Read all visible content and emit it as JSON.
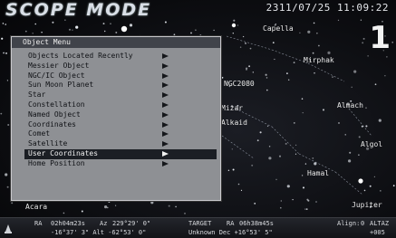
{
  "header": {
    "title": "SCOPE MODE",
    "datetime": "2311/07/25 11:09:22",
    "big_number": "1"
  },
  "sky_labels": [
    {
      "id": "capella",
      "text": "Capella"
    },
    {
      "id": "mirphak",
      "text": "Mirphak"
    },
    {
      "id": "alcor",
      "text": "Alcor"
    },
    {
      "id": "mizar",
      "text": "Mizar"
    },
    {
      "id": "alkaid",
      "text": "Alkaid"
    },
    {
      "id": "almach",
      "text": "Almach"
    },
    {
      "id": "algol",
      "text": "Algol"
    },
    {
      "id": "jupiter",
      "text": "Jupiter"
    },
    {
      "id": "hamal",
      "text": "Hamal"
    },
    {
      "id": "acara",
      "text": "Acara"
    },
    {
      "id": "ngc",
      "text": "NGC2080"
    }
  ],
  "menu": {
    "header": "Object Menu",
    "items": [
      {
        "label": "Objects Located Recently",
        "selected": false
      },
      {
        "label": "Messier Object",
        "selected": false
      },
      {
        "label": "NGC/IC Object",
        "selected": false
      },
      {
        "label": "Sun Moon Planet",
        "selected": false
      },
      {
        "label": "Star",
        "selected": false
      },
      {
        "label": "Constellation",
        "selected": false
      },
      {
        "label": "Named Object",
        "selected": false
      },
      {
        "label": "Coordinates",
        "selected": false
      },
      {
        "label": "Comet",
        "selected": false
      },
      {
        "label": "Satellite",
        "selected": false
      },
      {
        "label": "User Coordinates",
        "selected": true
      },
      {
        "label": "Home Position",
        "selected": false
      }
    ]
  },
  "status": {
    "ra_label": "RA",
    "ra_value": "02h04m23s",
    "az_label": "Az",
    "az_value": "229°29' 0\"",
    "dec_line": "-16°37' 3\"  Alt -62°53' 0\"",
    "target_label": "TARGET",
    "target_ra_label": "RA",
    "target_ra_value": "06h38m45s",
    "target_line": "Unknown Dec +16°53' 5\"",
    "align_label": "Align:",
    "align_value": "0",
    "alta_label": "ALTAZ",
    "mode_label": "+005"
  },
  "colors": {
    "menu_bg": "#8e9094",
    "menu_header_bg": "#40434a",
    "selected_bg": "#1b1e24",
    "sky_bg": "#0e0f13"
  }
}
